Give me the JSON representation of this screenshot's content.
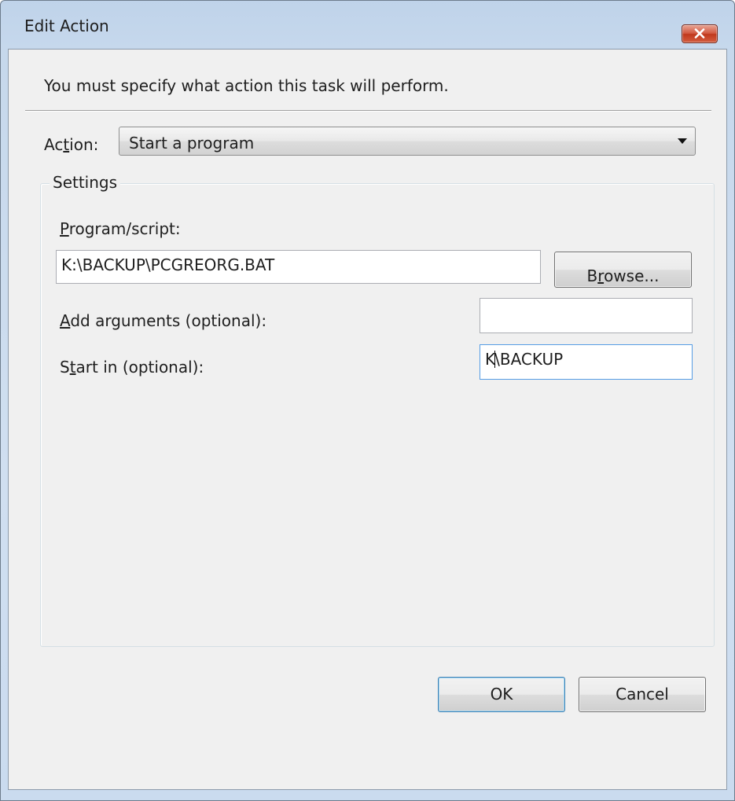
{
  "window": {
    "title": "Edit Action",
    "close_glyph": "✕"
  },
  "intro_text": "You must specify what action this task will perform.",
  "action": {
    "label_before": "Ac",
    "label_mnemonic": "t",
    "label_after": "ion:",
    "selected": "Start a program"
  },
  "settings": {
    "legend": "Settings",
    "program": {
      "label_mnemonic": "P",
      "label_rest": "rogram/script:",
      "value": "K:\\BACKUP\\PCGREORG.BAT"
    },
    "browse": {
      "label_before": "B",
      "label_mnemonic": "r",
      "label_after": "owse..."
    },
    "arguments": {
      "label_mnemonic": "A",
      "label_rest": "dd arguments (optional):",
      "value": ""
    },
    "start_in": {
      "label_before": "S",
      "label_mnemonic": "t",
      "label_after": "art in (optional):",
      "value_before_caret": "K",
      "value_after_caret": "\\BACKUP"
    }
  },
  "buttons": {
    "ok": "OK",
    "cancel": "Cancel"
  },
  "icons": {
    "close": "close-icon",
    "dropdown": "chevron-down-icon"
  },
  "colors": {
    "close_button": "#c0381c",
    "focus_border": "#569de5",
    "client_background": "#f0f0f0"
  }
}
